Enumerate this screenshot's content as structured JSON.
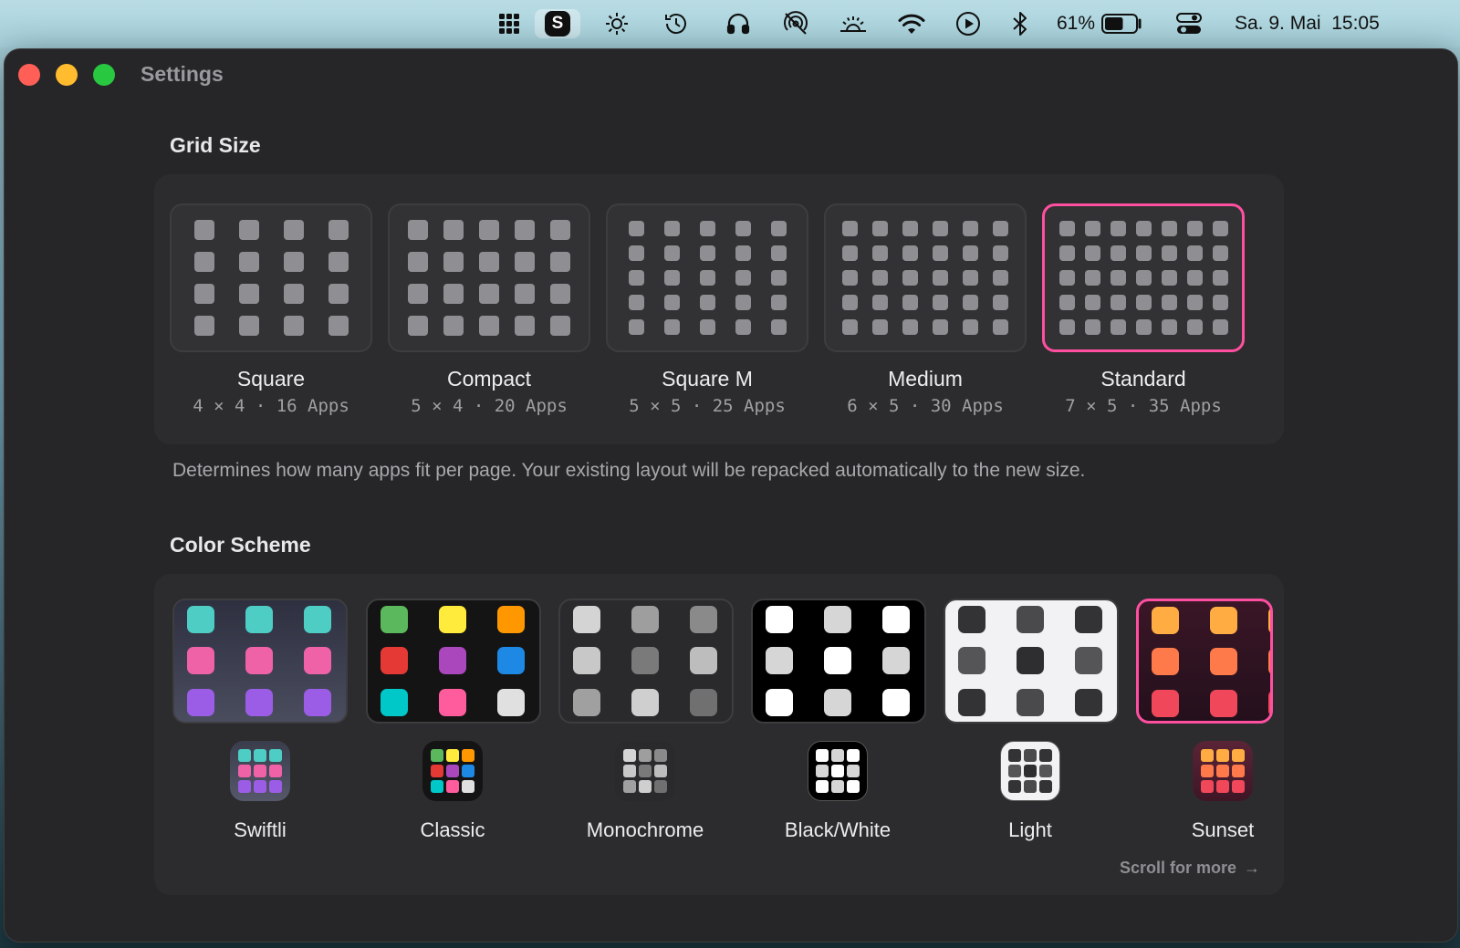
{
  "menubar": {
    "s_app_label": "S",
    "battery_percent": "61%",
    "battery_level": 0.61,
    "datetime": "Sa. 9. Mai  15:05"
  },
  "window": {
    "title": "Settings"
  },
  "grid_size": {
    "title": "Grid Size",
    "description": "Determines how many apps fit per page. Your existing layout will be repacked automatically to the new size.",
    "selected": "Standard",
    "options": [
      {
        "name": "Square",
        "cols": 4,
        "rows": 4,
        "subtitle": "4 × 4 · 16 Apps"
      },
      {
        "name": "Compact",
        "cols": 5,
        "rows": 4,
        "subtitle": "5 × 4 · 20 Apps"
      },
      {
        "name": "Square M",
        "cols": 5,
        "rows": 5,
        "subtitle": "5 × 5 · 25 Apps"
      },
      {
        "name": "Medium",
        "cols": 6,
        "rows": 5,
        "subtitle": "6 × 5 · 30 Apps"
      },
      {
        "name": "Standard",
        "cols": 7,
        "rows": 5,
        "subtitle": "7 × 5 · 35 Apps"
      }
    ]
  },
  "color_scheme": {
    "title": "Color Scheme",
    "selected": "Sunset",
    "scroll_hint": "Scroll for more",
    "options": [
      {
        "name": "Swiftli",
        "bg": "#3a3d4c",
        "colors": [
          "#4ecdc4",
          "#4ecdc4",
          "#4ecdc4",
          "#f062a8",
          "#f062a8",
          "#f062a8",
          "#9b5de5",
          "#9b5de5",
          "#9b5de5"
        ]
      },
      {
        "name": "Classic",
        "bg": "#141414",
        "colors": [
          "#5cb85c",
          "#ffeb3b",
          "#ff9800",
          "#e53935",
          "#ab47bc",
          "#1e88e5",
          "#00c8c8",
          "#ff5c9d",
          "#e0e0e0"
        ]
      },
      {
        "name": "Monochrome",
        "bg": "#2a2a2c",
        "colors": [
          "#d4d4d4",
          "#9e9e9e",
          "#8a8a8a",
          "#c8c8c8",
          "#7a7a7a",
          "#bdbdbd",
          "#a0a0a0",
          "#cfcfcf",
          "#707070"
        ]
      },
      {
        "name": "Black/White",
        "bg": "#000000",
        "colors": [
          "#ffffff",
          "#d6d6d6",
          "#ffffff",
          "#d6d6d6",
          "#ffffff",
          "#d6d6d6",
          "#ffffff",
          "#d6d6d6",
          "#ffffff"
        ]
      },
      {
        "name": "Light",
        "bg": "#f2f2f4",
        "colors": [
          "#333335",
          "#4a4a4c",
          "#333335",
          "#555557",
          "#2e2e30",
          "#555557",
          "#333335",
          "#4a4a4c",
          "#333335"
        ]
      },
      {
        "name": "Sunset",
        "bg": "#2e1422",
        "colors": [
          "#ffad42",
          "#ffad42",
          "#ffad42",
          "#ff7a4a",
          "#ff7a4a",
          "#ff7a4a",
          "#f0475a",
          "#f0475a",
          "#f0475a"
        ]
      }
    ]
  }
}
